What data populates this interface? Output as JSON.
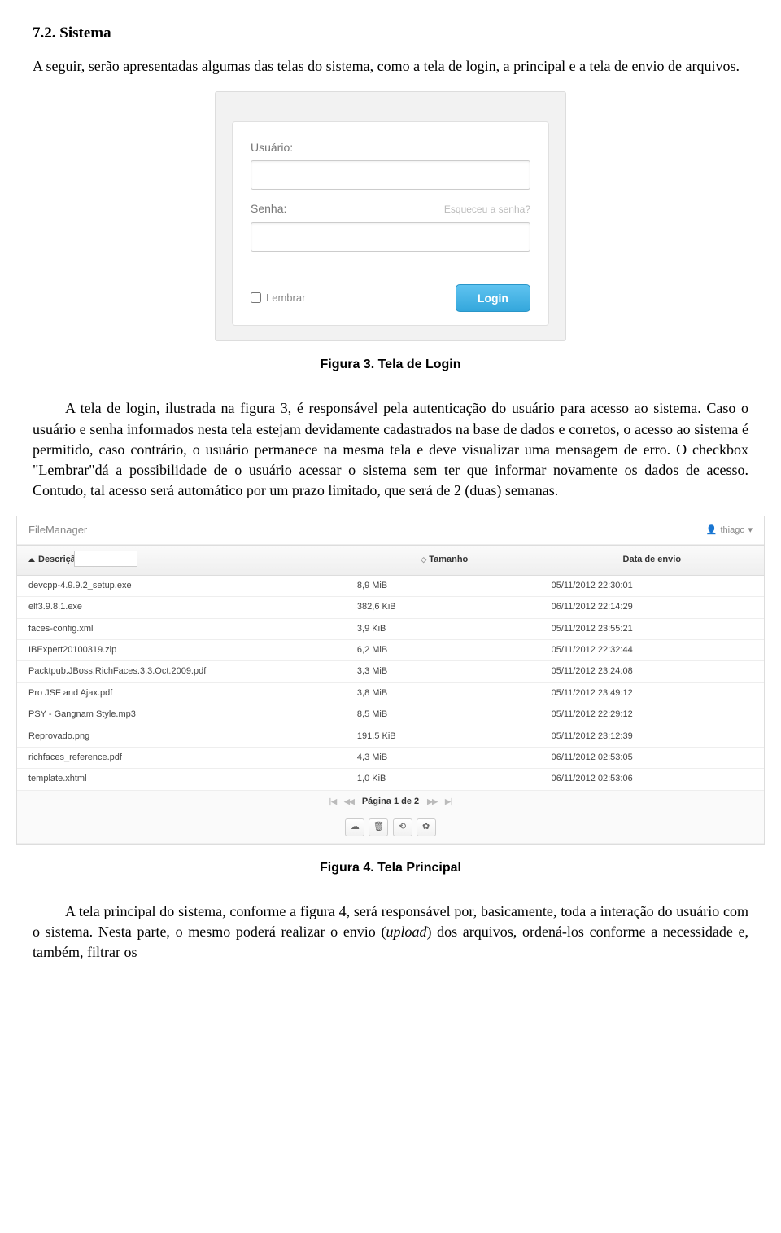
{
  "section_heading": "7.2. Sistema",
  "intro_para": "A seguir, serão apresentadas algumas das telas do sistema, como a tela de login, a principal e a tela de envio de arquivos.",
  "login": {
    "user_label": "Usuário:",
    "pass_label": "Senha:",
    "forgot": "Esqueceu a senha?",
    "remember": "Lembrar",
    "button": "Login"
  },
  "figure3_caption": "Figura 3. Tela de Login",
  "para_login": "A tela de login, ilustrada na figura 3, é responsável pela autenticação do usuário para acesso ao sistema. Caso o usuário e senha informados nesta tela estejam devidamente cadastrados na base de dados e corretos, o acesso ao sistema é permitido, caso contrário, o usuário permanece na mesma tela e deve visualizar uma mensagem de erro. O checkbox \"Lembrar\"dá a possibilidade de o usuário acessar o sistema sem ter que informar novamente os dados de acesso. Contudo, tal acesso será automático por um prazo limitado, que será de 2 (duas) semanas.",
  "filemanager": {
    "title": "FileManager",
    "user": "thiago",
    "columns": {
      "desc": "Descrição",
      "size": "Tamanho",
      "date": "Data de envio"
    },
    "rows": [
      {
        "desc": "devcpp-4.9.9.2_setup.exe",
        "size": "8,9 MiB",
        "date": "05/11/2012 22:30:01"
      },
      {
        "desc": "elf3.9.8.1.exe",
        "size": "382,6 KiB",
        "date": "06/11/2012 22:14:29"
      },
      {
        "desc": "faces-config.xml",
        "size": "3,9 KiB",
        "date": "05/11/2012 23:55:21"
      },
      {
        "desc": "IBExpert20100319.zip",
        "size": "6,2 MiB",
        "date": "05/11/2012 22:32:44"
      },
      {
        "desc": "Packtpub.JBoss.RichFaces.3.3.Oct.2009.pdf",
        "size": "3,3 MiB",
        "date": "05/11/2012 23:24:08"
      },
      {
        "desc": "Pro JSF and Ajax.pdf",
        "size": "3,8 MiB",
        "date": "05/11/2012 23:49:12"
      },
      {
        "desc": "PSY - Gangnam Style.mp3",
        "size": "8,5 MiB",
        "date": "05/11/2012 22:29:12"
      },
      {
        "desc": "Reprovado.png",
        "size": "191,5 KiB",
        "date": "05/11/2012 23:12:39"
      },
      {
        "desc": "richfaces_reference.pdf",
        "size": "4,3 MiB",
        "date": "06/11/2012 02:53:05"
      },
      {
        "desc": "template.xhtml",
        "size": "1,0 KiB",
        "date": "06/11/2012 02:53:06"
      }
    ],
    "pager": "Página 1 de 2",
    "toolbar_icons": [
      "upload-icon",
      "delete-icon",
      "refresh-icon",
      "settings-icon"
    ]
  },
  "figure4_caption": "Figura 4. Tela Principal",
  "para_final_pre": "A tela principal do sistema, conforme a figura 4, será responsável por, basicamente, toda a interação do usuário com o sistema. Nesta parte, o mesmo poderá realizar o envio (",
  "para_final_italic": "upload",
  "para_final_post": ") dos arquivos, ordená-los conforme a necessidade e, também, filtrar os"
}
